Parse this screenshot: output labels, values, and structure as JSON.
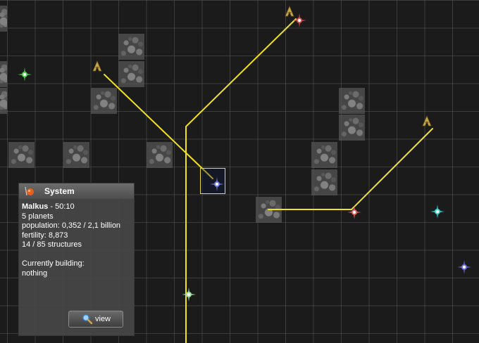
{
  "panel": {
    "title": "System",
    "system_name": "Malkus",
    "coords": " - 50:10",
    "planets": "5 planets",
    "population": "population: 0,352 / 2,1 billion",
    "fertility": "fertility: 8,873",
    "structures": "14 / 85 structures",
    "building_label": "Currently building:",
    "building_value": "nothing",
    "view_button": "view"
  },
  "map": {
    "route_color": "#f2e21a",
    "selection_color": "#e8d84a",
    "star_colors": [
      "#d94a4a",
      "#4cd24c",
      "#6a7ae0",
      "#e06060",
      "#3ad6d6",
      "#6a6ae0",
      "#9be09b"
    ],
    "icons": [
      "ship-icon",
      "star-icon",
      "asteroid-field",
      "search-icon",
      "system-icon"
    ]
  }
}
